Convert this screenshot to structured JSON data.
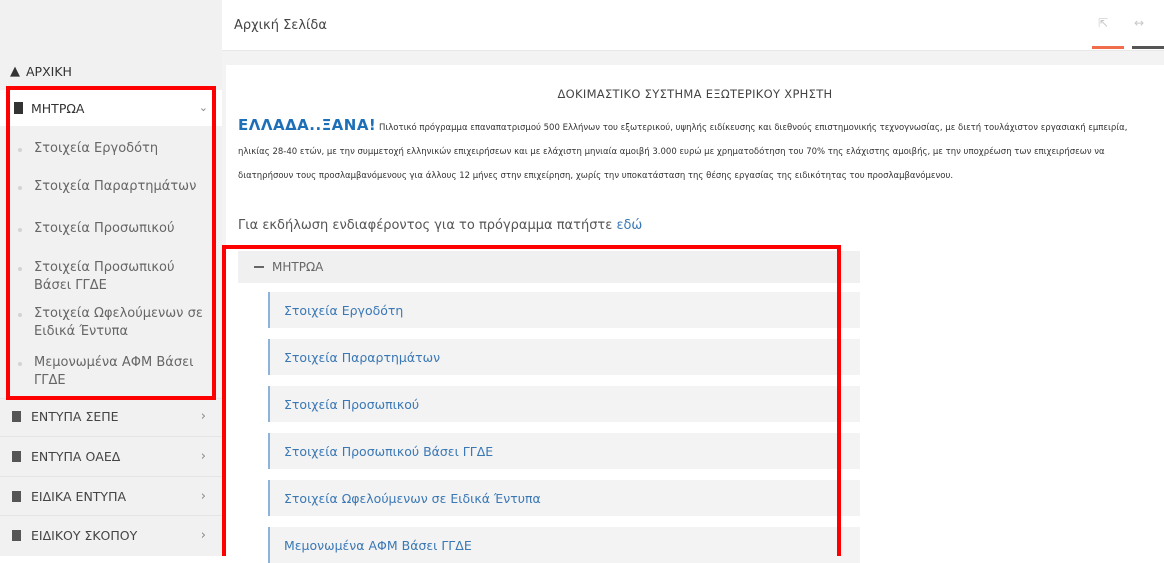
{
  "header": {
    "title": "Αρχική Σελίδα"
  },
  "sidebar": {
    "home": "ΑΡΧΙΚΗ",
    "active_section": "ΜΗΤΡΩΑ",
    "sub_items": [
      "Στοιχεία Εργοδότη",
      "Στοιχεία Παραρτημάτων",
      "Στοιχεία Προσωπικού",
      "Στοιχεία Προσωπικού Βάσει ΓΓΔΕ",
      "Στοιχεία Ωφελούμενων σε Ειδικά Έντυπα",
      "Μεμονωμένα ΑΦΜ Βάσει ΓΓΔΕ"
    ],
    "categories": [
      "ΕΝΤΥΠΑ ΣΕΠΕ",
      "ΕΝΤΥΠΑ ΟΑΕΔ",
      "ΕΙΔΙΚΑ ΕΝΤΥΠΑ",
      "ΕΙΔΙΚΟΥ ΣΚΟΠΟΥ"
    ]
  },
  "main": {
    "system_title": "ΔΟΚΙΜΑΣΤΙΚΟ ΣΥΣΤΗΜΑ ΕΞΩΤΕΡΙΚΟΥ ΧΡΗΣΤΗ",
    "brand": "ΕΛΛΑΔΑ..ΞΑΝΑ!",
    "intro_text": "Πιλοτικό πρόγραμμα επαναπατρισμού 500 Ελλήνων του εξωτερικού, υψηλής ειδίκευσης και διεθνούς επιστημονικής τεχνογνωσίας, με διετή τουλάχιστον εργασιακή εμπειρία, ηλικίας 28-40 ετών, με την συμμετοχή ελληνικών επιχειρήσεων και με ελάχιστη μηνιαία αμοιβή 3.000 ευρώ με χρηματοδότηση του 70% της ελάχιστης αμοιβής, με την υποχρέωση των επιχειρήσεων να διατηρήσουν τους προσλαμβανόμενους για άλλους 12 μήνες στην επιχείρηση, χωρίς την υποκατάσταση της θέσης εργασίας της ειδικότητας του προσλαμβανόμενου.",
    "interest_text": "Για εκδήλωση ενδιαφέροντος για το πρόγραμμα πατήστε",
    "interest_link": "εδώ",
    "tree_title": "ΜΗΤΡΩΑ",
    "tree_items": [
      "Στοιχεία Εργοδότη",
      "Στοιχεία Παραρτημάτων",
      "Στοιχεία Προσωπικού",
      "Στοιχεία Προσωπικού Βάσει ΓΓΔΕ",
      "Στοιχεία Ωφελούμενων σε Ειδικά Έντυπα",
      "Μεμονωμένα ΑΦΜ Βάσει ΓΓΔΕ"
    ]
  },
  "colors": {
    "accent": "#1d6fb8",
    "link": "#3a78b5",
    "highlight": "#ff0000",
    "tab_accent": "#ef6d4a"
  }
}
